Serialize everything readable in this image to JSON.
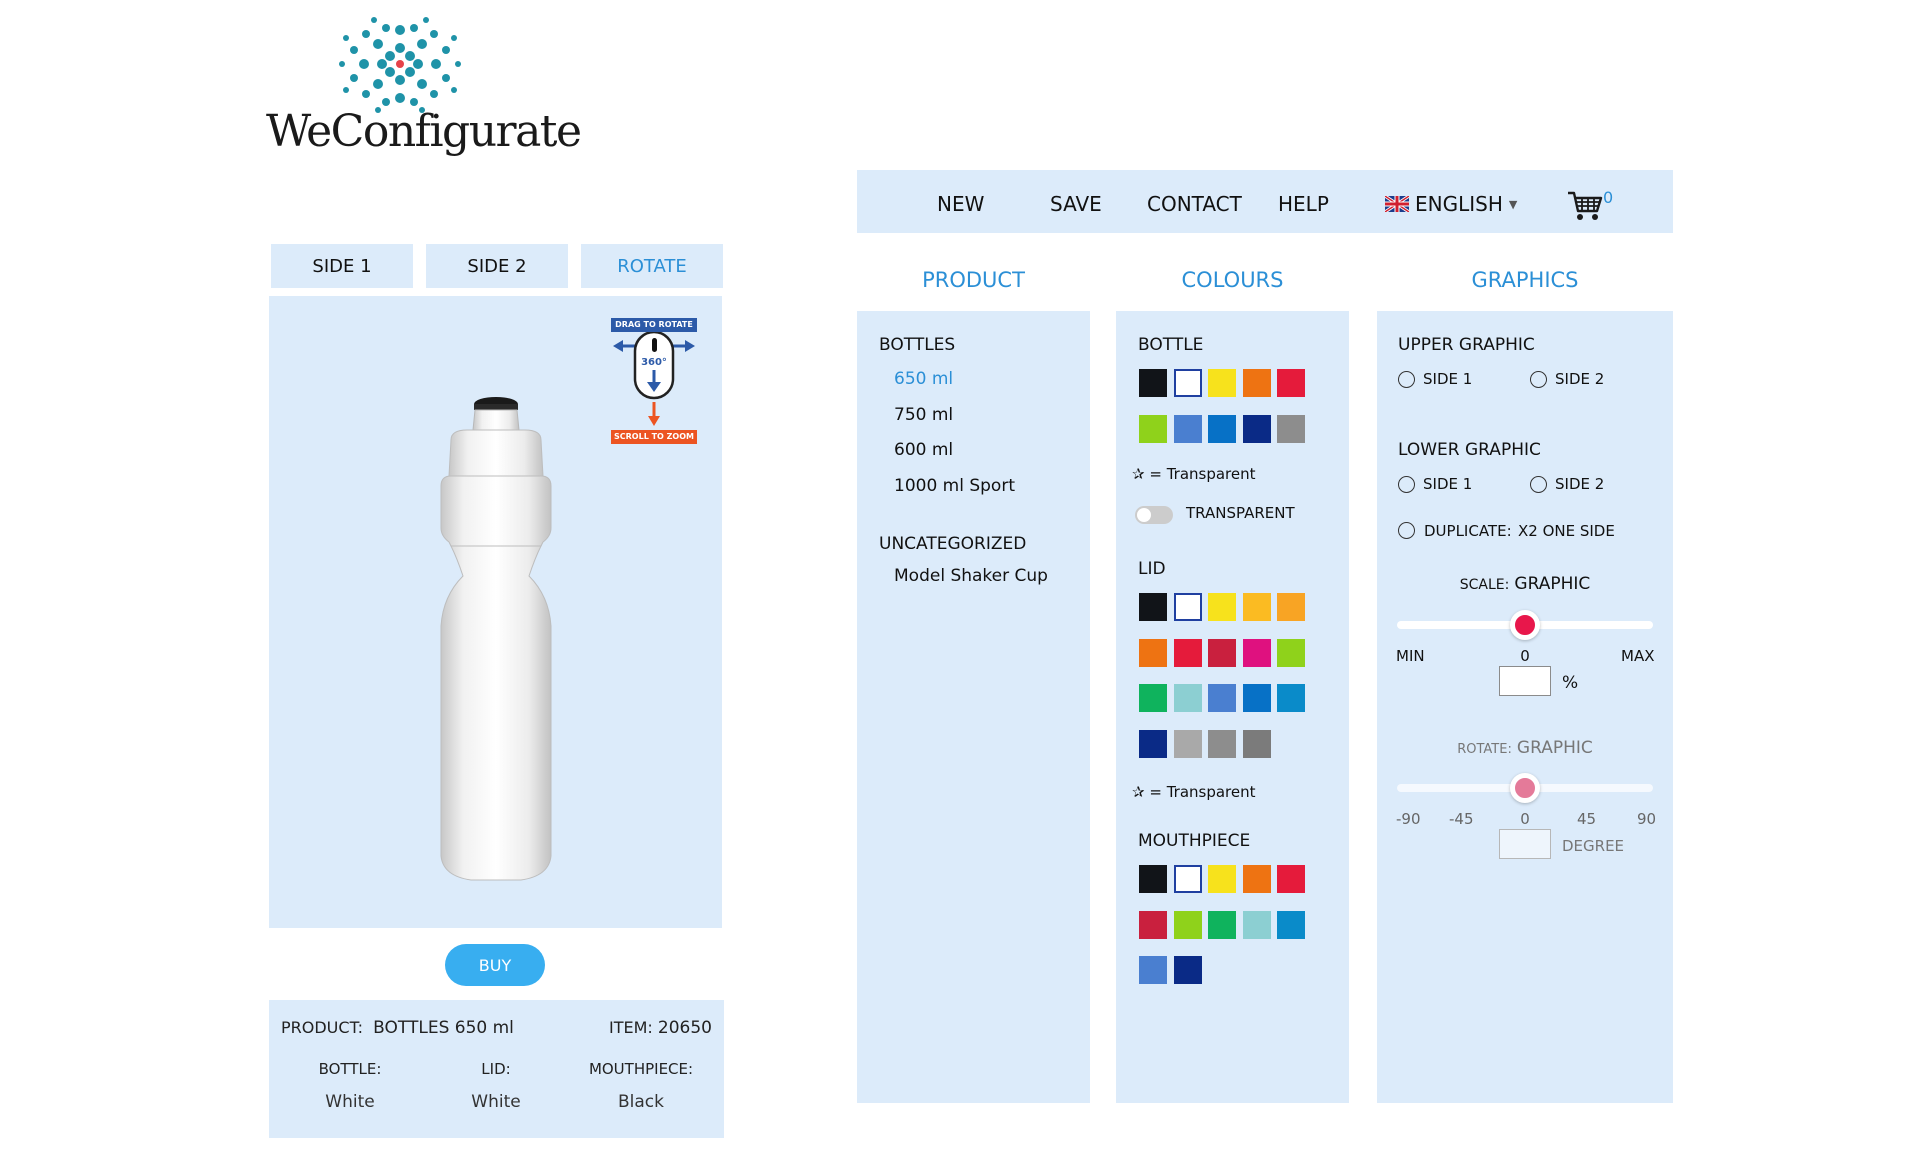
{
  "logo": {
    "text": "WeConfigurate"
  },
  "tabs": [
    {
      "label": "SIDE 1",
      "active": false
    },
    {
      "label": "SIDE 2",
      "active": false
    },
    {
      "label": "ROTATE",
      "active": true
    }
  ],
  "viewer": {
    "hint_top": "DRAG TO ROTATE",
    "hint_center": "360°",
    "hint_bottom": "SCROLL TO ZOOM"
  },
  "buy_label": "BUY",
  "summary": {
    "product_label": "PRODUCT:",
    "product_value": "BOTTLES 650 ml",
    "item_label": "ITEM:",
    "item_value": "20650",
    "parts": [
      {
        "label": "BOTTLE:",
        "value": "White"
      },
      {
        "label": "LID:",
        "value": "White"
      },
      {
        "label": "MOUTHPIECE:",
        "value": "Black"
      }
    ]
  },
  "nav": {
    "items": [
      "NEW",
      "SAVE",
      "CONTACT",
      "HELP"
    ],
    "language": "ENGLISH",
    "cart_count": "0"
  },
  "product": {
    "title": "PRODUCT",
    "groups": [
      {
        "name": "BOTTLES",
        "items": [
          "650 ml",
          "750 ml",
          "600 ml",
          "1000 ml Sport"
        ],
        "selected": 0
      },
      {
        "name": "UNCATEGORIZED",
        "items": [
          "Model Shaker Cup"
        ]
      }
    ]
  },
  "colours": {
    "title": "COLOURS",
    "bottle": {
      "label": "BOTTLE",
      "swatches": [
        "#111418",
        "#ffffff",
        "#f7e21c",
        "#ee7312",
        "#e51b3b",
        "#8fd21b",
        "#4a7fd0",
        "#0771c6",
        "#0a2a86",
        "#8d8d8d"
      ],
      "transparent_note": "= Transparent",
      "toggle_label": "TRANSPARENT"
    },
    "lid": {
      "label": "LID",
      "swatches": [
        "#111418",
        "#ffffff",
        "#f7e21c",
        "#fbbb22",
        "#f8a424",
        "#ee7312",
        "#e51b3b",
        "#c9203e",
        "#df117f",
        "#8fd21b",
        "#0fb35d",
        "#8ccfd2",
        "#4a7fd0",
        "#0771c6",
        "#0a8bc9",
        "#0a2a86",
        "#a9a9a9",
        "#8d8d8d",
        "#7b7b7b"
      ],
      "transparent_note": "= Transparent"
    },
    "mouthpiece": {
      "label": "MOUTHPIECE",
      "swatches": [
        "#111418",
        "#ffffff",
        "#f7e21c",
        "#ee7312",
        "#e51b3b",
        "#c9203e",
        "#8fd21b",
        "#0fb35d",
        "#8ccfd2",
        "#0a8bc9",
        "#4a7fd0",
        "#0a2a86"
      ]
    }
  },
  "graphics": {
    "title": "GRAPHICS",
    "upper_label": "UPPER GRAPHIC",
    "lower_label": "LOWER GRAPHIC",
    "side1": "SIDE 1",
    "side2": "SIDE 2",
    "duplicate_label": "DUPLICATE:",
    "duplicate_value": "X2 ONE SIDE",
    "scale_label": "SCALE:",
    "scale_target": "GRAPHIC",
    "scale_min": "MIN",
    "scale_value": "0",
    "scale_max": "MAX",
    "scale_unit": "%",
    "scale_position": 0.5,
    "rotate_label": "ROTATE:",
    "rotate_target": "GRAPHIC",
    "rotate_ticks": [
      "-90",
      "-45",
      "0",
      "45",
      "90"
    ],
    "rotate_unit": "DEGREE",
    "rotate_position": 0.5
  },
  "colors": {
    "panel": "#dcebfa",
    "accent": "#2b8fd6",
    "buy": "#38aef0",
    "knob": "#e8174b"
  }
}
